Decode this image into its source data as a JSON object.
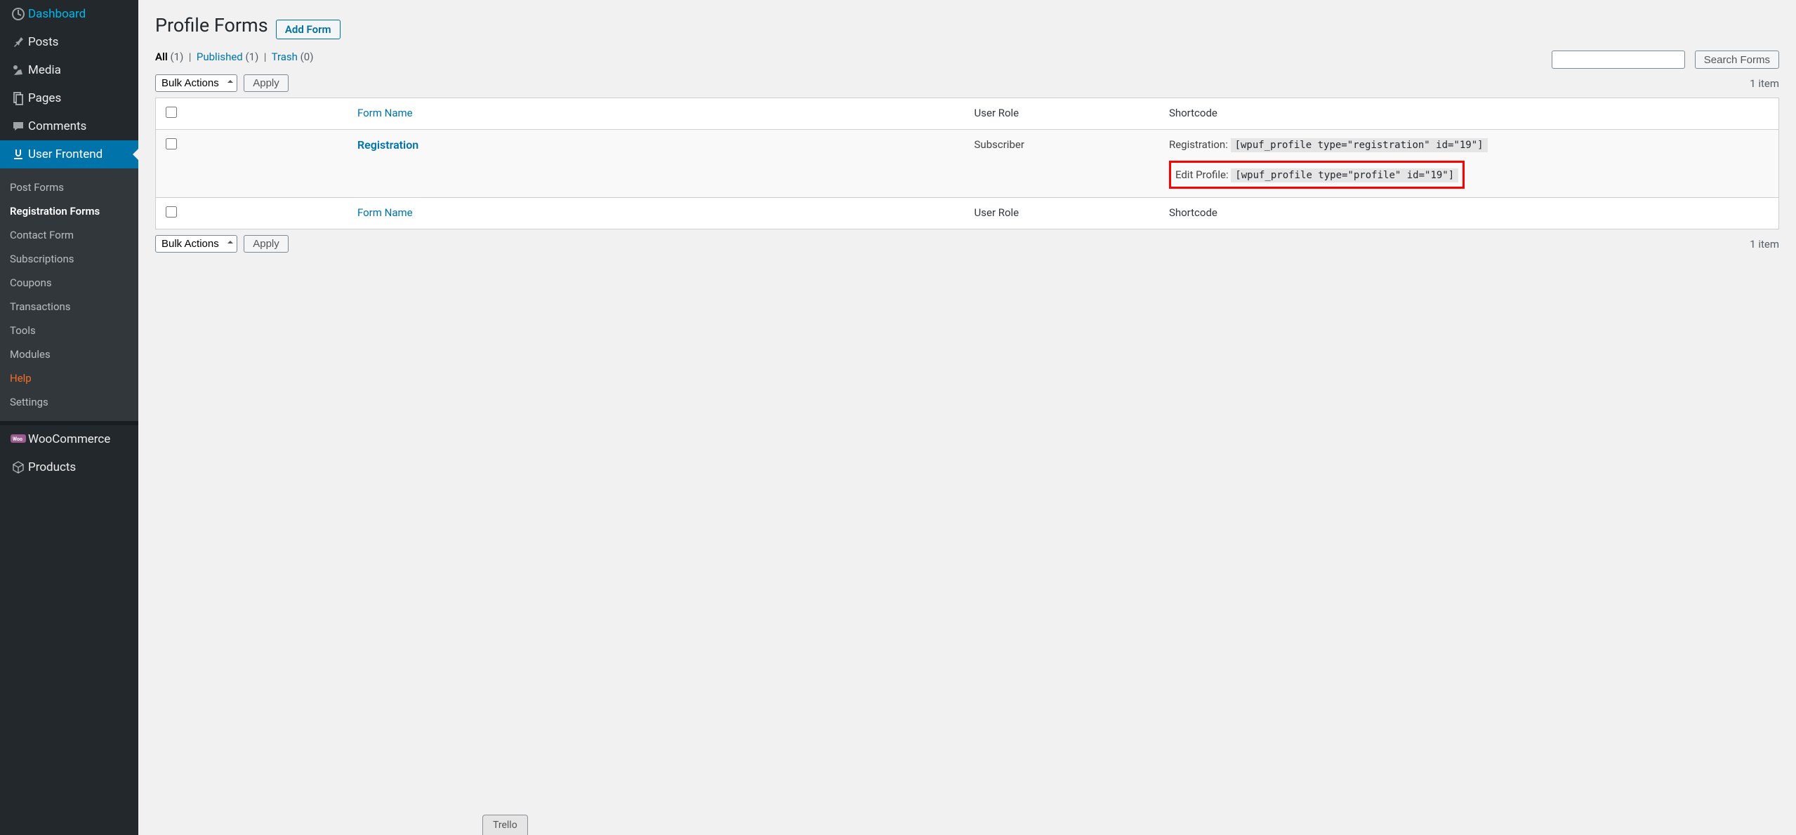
{
  "sidebar": {
    "items": [
      {
        "label": "Dashboard",
        "icon": "dashboard"
      },
      {
        "label": "Posts",
        "icon": "pin"
      },
      {
        "label": "Media",
        "icon": "media"
      },
      {
        "label": "Pages",
        "icon": "pages"
      },
      {
        "label": "Comments",
        "icon": "comment"
      },
      {
        "label": "User Frontend",
        "icon": "uf"
      },
      {
        "label": "WooCommerce",
        "icon": "woo"
      },
      {
        "label": "Products",
        "icon": "products"
      }
    ],
    "submenu": [
      {
        "label": "Post Forms"
      },
      {
        "label": "Registration Forms"
      },
      {
        "label": "Contact Form"
      },
      {
        "label": "Subscriptions"
      },
      {
        "label": "Coupons"
      },
      {
        "label": "Transactions"
      },
      {
        "label": "Tools"
      },
      {
        "label": "Modules"
      },
      {
        "label": "Help"
      },
      {
        "label": "Settings"
      }
    ]
  },
  "header": {
    "title": "Profile Forms",
    "add_button": "Add Form"
  },
  "filters": {
    "all_label": "All",
    "all_count": "(1)",
    "published_label": "Published",
    "published_count": "(1)",
    "trash_label": "Trash",
    "trash_count": "(0)"
  },
  "bulk": {
    "select_label": "Bulk Actions",
    "apply_label": "Apply"
  },
  "search": {
    "button": "Search Forms"
  },
  "count_text": "1 item",
  "table": {
    "col_form": "Form Name",
    "col_role": "User Role",
    "col_short": "Shortcode",
    "row": {
      "title": "Registration",
      "role": "Subscriber",
      "reg_label": "Registration: ",
      "reg_code": "[wpuf_profile type=\"registration\" id=\"19\"]",
      "edit_label": "Edit Profile: ",
      "edit_code": "[wpuf_profile type=\"profile\" id=\"19\"]"
    }
  },
  "floater": "Trello"
}
